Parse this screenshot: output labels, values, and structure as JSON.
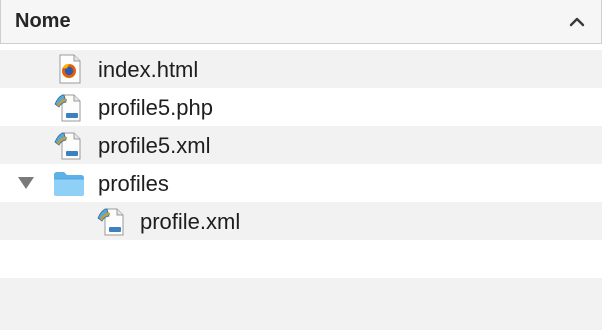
{
  "header": {
    "title": "Nome",
    "sort": "ascending"
  },
  "files": [
    {
      "name": "index.html",
      "icon": "firefox-html-icon",
      "depth": 0
    },
    {
      "name": "profile5.php",
      "icon": "script-document-icon",
      "depth": 0
    },
    {
      "name": "profile5.xml",
      "icon": "script-document-icon",
      "depth": 0
    },
    {
      "name": "profiles",
      "icon": "folder-icon",
      "depth": 0,
      "expanded": true
    },
    {
      "name": "profile.xml",
      "icon": "script-document-icon",
      "depth": 1
    }
  ],
  "empty_row_count": 2
}
